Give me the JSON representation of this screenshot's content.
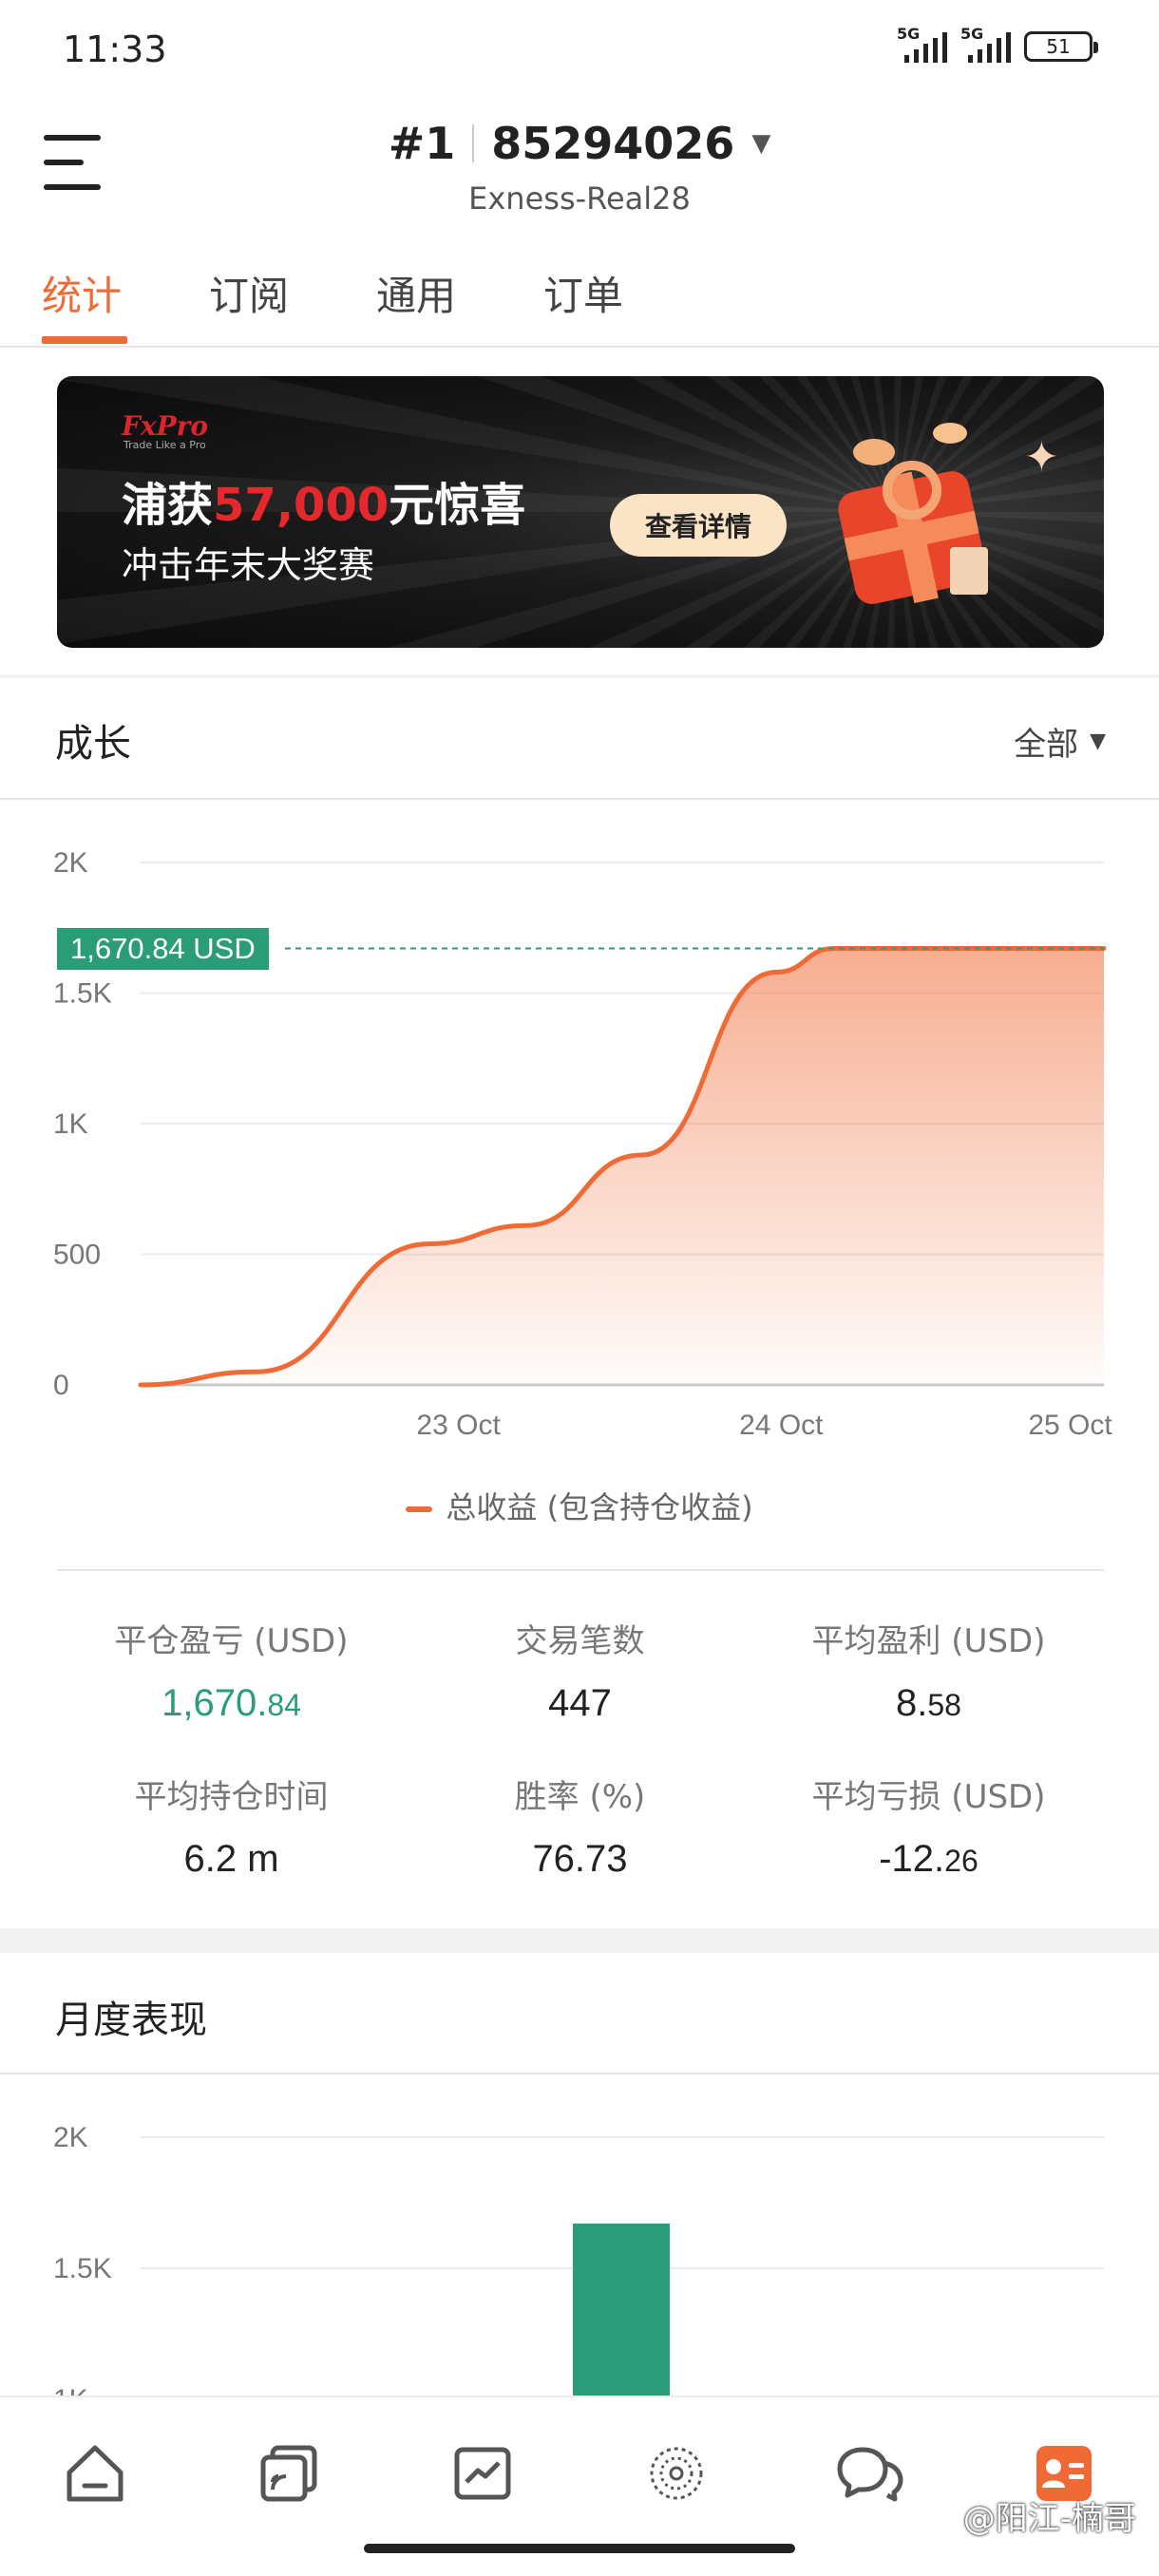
{
  "status_bar": {
    "time": "11:33",
    "network_1": "5G",
    "network_2": "5G",
    "battery": "51"
  },
  "header": {
    "account_index": "#1",
    "account_number": "85294026",
    "server": "Exness-Real28",
    "menu_icon": "hamburger-menu-icon",
    "dropdown_icon": "caret-down-icon"
  },
  "tabs": [
    {
      "label": "统计",
      "active": true
    },
    {
      "label": "订阅",
      "active": false
    },
    {
      "label": "通用",
      "active": false
    },
    {
      "label": "订单",
      "active": false
    }
  ],
  "banner": {
    "brand": "FxPro",
    "brand_tagline": "Trade Like a Pro",
    "headline_prefix": "浦获",
    "headline_amount": "57,000",
    "headline_suffix": "元惊喜",
    "subline": "冲击年末大奖赛",
    "cta_label": "查看详情"
  },
  "growth": {
    "title": "成长",
    "range_label": "全部",
    "current_value_label": "1,670.84 USD",
    "legend_label": "总收益 (包含持仓收益)"
  },
  "chart_data": [
    {
      "type": "area",
      "title": "成长",
      "x_ticks": [
        "23 Oct",
        "24 Oct",
        "25 Oct"
      ],
      "y_ticks": [
        "0",
        "500",
        "1K",
        "1.5K",
        "2K"
      ],
      "ylim": [
        0,
        2000
      ],
      "grid": true,
      "legend_placement": "bottom-center",
      "series": [
        {
          "name": "总收益 (包含持仓收益)",
          "color": "#f06a35",
          "x": [
            "22 Oct",
            "22 Oct",
            "23 Oct",
            "23 Oct",
            "23 Oct",
            "24 Oct",
            "24 Oct",
            "25 Oct"
          ],
          "points": [
            {
              "x": 0.0,
              "y": 0
            },
            {
              "x": 0.12,
              "y": 50
            },
            {
              "x": 0.3,
              "y": 540
            },
            {
              "x": 0.4,
              "y": 610
            },
            {
              "x": 0.52,
              "y": 880
            },
            {
              "x": 0.66,
              "y": 1580
            },
            {
              "x": 0.72,
              "y": 1670.84
            },
            {
              "x": 1.0,
              "y": 1670.84
            }
          ]
        }
      ],
      "marker_value": 1670.84
    },
    {
      "type": "bar",
      "title": "月度表现",
      "y_ticks": [
        "2K",
        "1.5K",
        "1K"
      ],
      "ylim": [
        0,
        2000
      ],
      "grid": true,
      "series": [
        {
          "color": "#2a9d78",
          "values": [
            1670.84
          ]
        }
      ]
    }
  ],
  "stats": [
    {
      "label": "平仓盈亏 (USD)",
      "int": "1,670.",
      "dec": "84",
      "green": true
    },
    {
      "label": "交易笔数",
      "int": "447",
      "dec": "",
      "green": false
    },
    {
      "label": "平均盈利 (USD)",
      "int": "8.",
      "dec": "58",
      "green": false
    },
    {
      "label": "平均持仓时间",
      "int": "6.2 m",
      "dec": "",
      "green": false
    },
    {
      "label": "胜率 (%)",
      "int": "76.73",
      "dec": "",
      "green": false
    },
    {
      "label": "平均亏损 (USD)",
      "int": "-12.",
      "dec": "26",
      "green": false
    }
  ],
  "monthly": {
    "title": "月度表现"
  },
  "bottom_nav": [
    {
      "icon": "home-icon"
    },
    {
      "icon": "copy-signals-icon"
    },
    {
      "icon": "trend-chart-icon"
    },
    {
      "icon": "discover-icon"
    },
    {
      "icon": "chat-icon"
    },
    {
      "icon": "profile-card-icon",
      "active": true
    }
  ],
  "watermark": "@阳江-楠哥",
  "colors": {
    "accent": "#f06a35",
    "green": "#2a9d78",
    "banner_red": "#e4282b"
  }
}
